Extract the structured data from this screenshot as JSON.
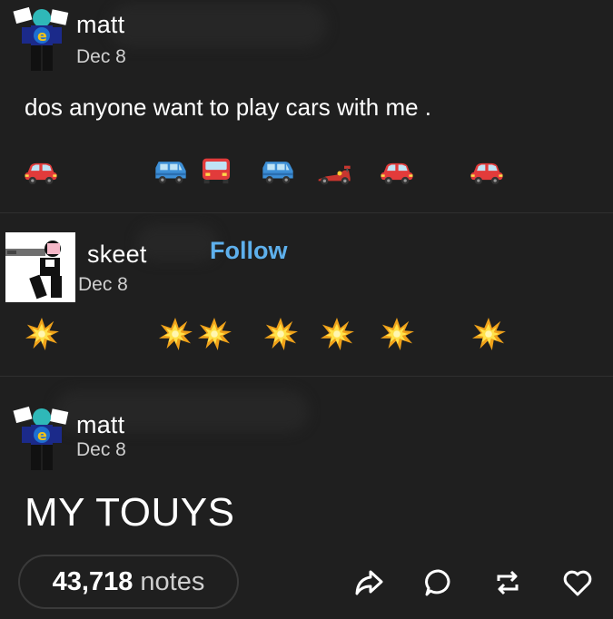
{
  "posts": [
    {
      "author": "matt",
      "date": "Dec 8",
      "text": "dos anyone want to play cars with me .",
      "emojis": [
        "red-car",
        "blue-suv",
        "red-bus",
        "blue-suv",
        "race-car",
        "red-car",
        "red-car"
      ]
    },
    {
      "author": "skeet",
      "date": "Dec 8",
      "follow_label": "Follow",
      "emojis": [
        "collision",
        "collision",
        "collision",
        "collision",
        "collision",
        "collision",
        "collision"
      ]
    },
    {
      "author": "matt",
      "date": "Dec 8",
      "text": "MY TOUYS"
    }
  ],
  "footer": {
    "notes_count": "43,718",
    "notes_label": "notes",
    "actions": [
      "share-icon",
      "reply-icon",
      "reblog-icon",
      "like-icon"
    ]
  },
  "colors": {
    "background": "#1f1f1f",
    "follow": "#5eb0ec",
    "divider": "#2f2f2f"
  }
}
